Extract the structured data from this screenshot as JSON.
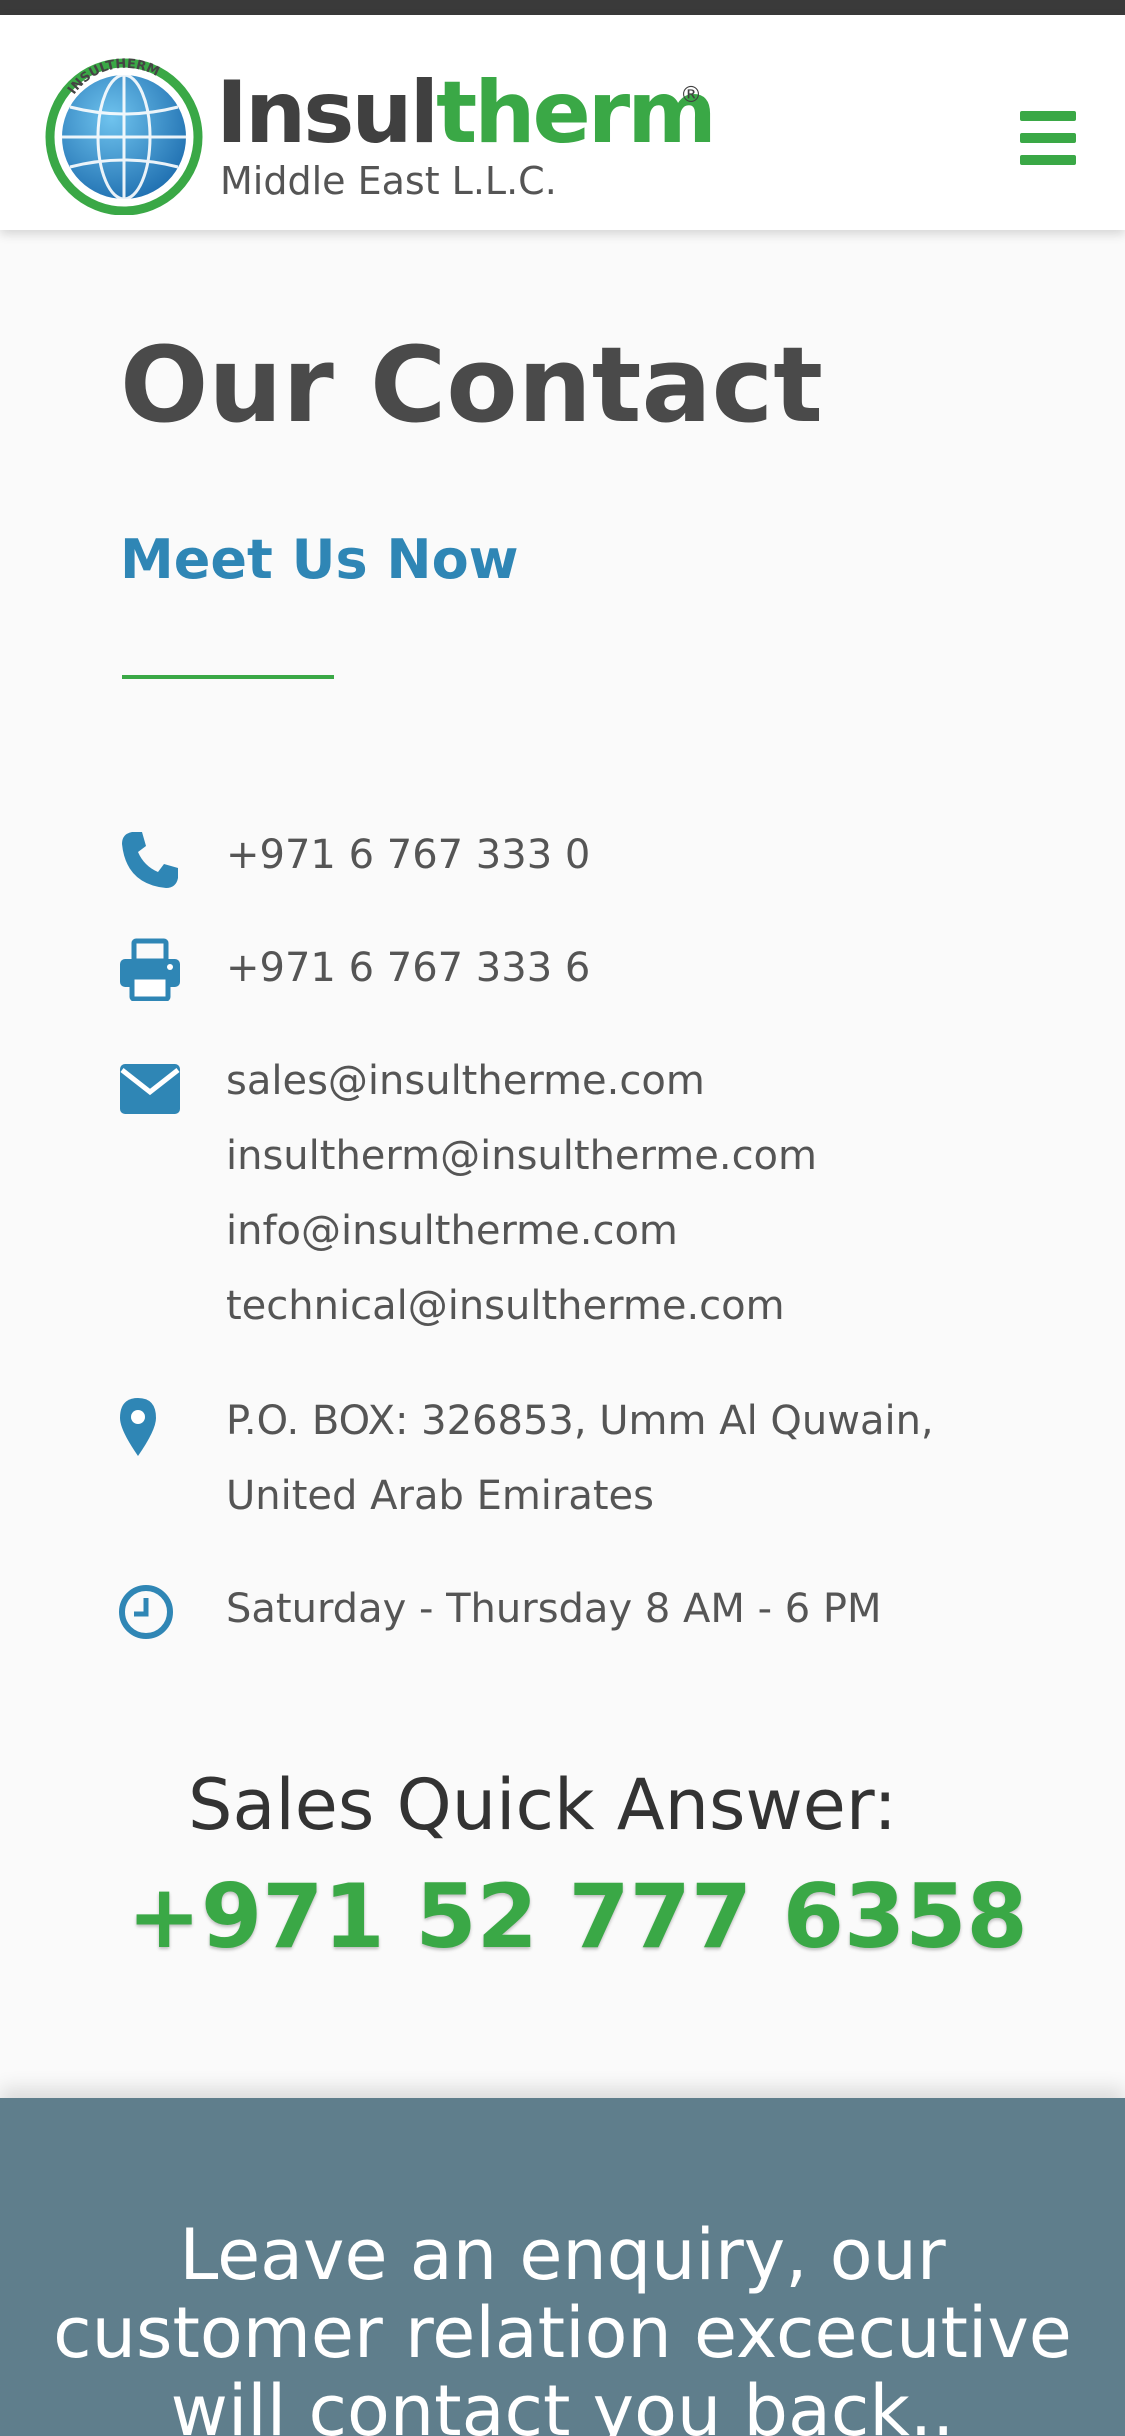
{
  "header": {
    "logo_word_dark": "Insul",
    "logo_word_green": "therm",
    "logo_reg": "®",
    "logo_sub": "Middle East L.L.C.",
    "logo_arc": "INSULTHERM",
    "menu_icon": "hamburger-menu-icon"
  },
  "page": {
    "title": "Our Contact",
    "subtitle": "Meet Us Now"
  },
  "contact": {
    "phone": {
      "icon": "phone-icon",
      "text": "+971 6 767 333 0"
    },
    "fax": {
      "icon": "printer-icon",
      "text": "+971 6 767 333 6"
    },
    "email": {
      "icon": "envelope-icon",
      "addresses": [
        "sales@insultherme.com",
        "insultherm@insultherme.com",
        "info@insultherme.com",
        "technical@insultherme.com"
      ]
    },
    "address": {
      "icon": "map-marker-icon",
      "line1": "P.O. BOX: 326853, Umm Al Quwain,",
      "line2": "United Arab Emirates"
    },
    "hours": {
      "icon": "clock-icon",
      "text": "Saturday - Thursday 8 AM - 6 PM"
    }
  },
  "sales": {
    "label": "Sales Quick Answer:",
    "phone": "+971 52 777 6358"
  },
  "enquiry": {
    "text": "Leave an enquiry, our customer relation excecutive will contact you back.."
  },
  "colors": {
    "brand_green": "#3aa846",
    "accent_blue": "#2f86b5",
    "enquiry_bg": "#5f7e8c",
    "text_gray": "#555555"
  }
}
